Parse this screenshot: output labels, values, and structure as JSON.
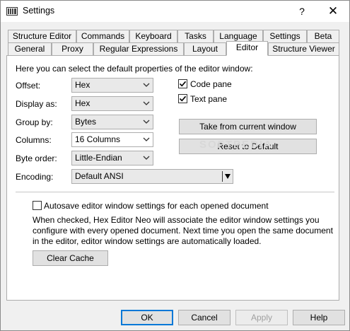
{
  "window": {
    "title": "Settings",
    "help_glyph": "?",
    "close_glyph": "✕"
  },
  "tabs_row1": [
    {
      "label": "Structure Editor"
    },
    {
      "label": "Commands"
    },
    {
      "label": "Keyboard"
    },
    {
      "label": "Tasks"
    },
    {
      "label": "Language"
    },
    {
      "label": "Settings"
    },
    {
      "label": "Beta"
    }
  ],
  "tabs_row2": [
    {
      "label": "General"
    },
    {
      "label": "Proxy"
    },
    {
      "label": "Regular Expressions"
    },
    {
      "label": "Layout"
    },
    {
      "label": "Editor"
    },
    {
      "label": "Structure Viewer"
    }
  ],
  "active_tab": "Editor",
  "editor": {
    "intro": "Here you can select the default properties of the editor window:",
    "offset": {
      "label": "Offset:",
      "value": "Hex"
    },
    "display_as": {
      "label": "Display as:",
      "value": "Hex"
    },
    "group_by": {
      "label": "Group by:",
      "value": "Bytes"
    },
    "columns": {
      "label": "Columns:",
      "value": "16 Columns"
    },
    "byte_order": {
      "label": "Byte order:",
      "value": "Little-Endian"
    },
    "encoding": {
      "label": "Encoding:",
      "value": "Default ANSI"
    },
    "code_pane": {
      "label": "Code pane",
      "checked": true
    },
    "text_pane": {
      "label": "Text pane",
      "checked": true
    },
    "take_from_current": "Take from current window",
    "reset_to_default": "Reset to Default",
    "autosave": {
      "label": "Autosave editor window settings for each opened document",
      "checked": false
    },
    "autosave_desc": "When checked, Hex Editor Neo will associate the editor window settings you configure with every opened document. Next time you open the same document in the editor, editor window settings are automatically loaded.",
    "clear_cache": "Clear Cache"
  },
  "footer": {
    "ok": "OK",
    "cancel": "Cancel",
    "apply": "Apply",
    "help": "Help"
  },
  "watermark": "SOFTPEDIA",
  "colors": {
    "focus_border": "#0078d7",
    "panel_border": "#adadad",
    "background": "#f0f0f0"
  }
}
